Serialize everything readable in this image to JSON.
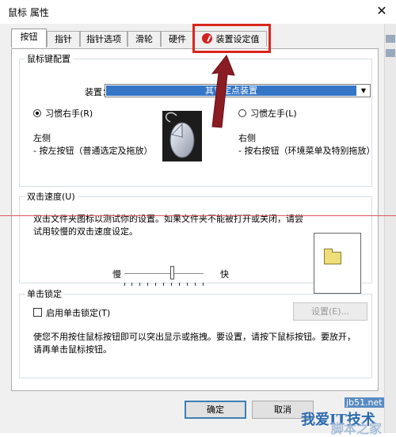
{
  "window": {
    "title": "鼠标 属性",
    "close_glyph": "✕"
  },
  "tabs": [
    {
      "label": "按钮",
      "active": true
    },
    {
      "label": "指针",
      "active": false
    },
    {
      "label": "指针选项",
      "active": false
    },
    {
      "label": "滑轮",
      "active": false
    },
    {
      "label": "硬件",
      "active": false
    },
    {
      "label": "装置设定值",
      "active": false,
      "icon": "synaptics-icon"
    }
  ],
  "button_config": {
    "legend": "鼠标键配置",
    "device_label": "装置：(V)",
    "device_value": "其它定点装置",
    "right_hand_label": "习惯右手(R)",
    "right_hand_checked": true,
    "left_hand_label": "习惯左手(L)",
    "left_hand_checked": false,
    "left_side_title": "左侧",
    "left_side_desc": "- 按左按钮（普通选定及拖放）",
    "right_side_title": "右侧",
    "right_side_desc": "- 按右按钮（环境菜单及特别拖放）"
  },
  "double_click": {
    "legend": "双击速度(U)",
    "description_line1": "双击文件夹图标以测试你的设置。如果文件夹不能被打开或关闭，请尝",
    "description_line2": "试用较慢的双击速度设定。",
    "slow_label": "慢",
    "fast_label": "快",
    "speed_fraction": 0.6
  },
  "click_lock": {
    "legend": "单击锁定",
    "checkbox_label": "启用单击锁定(T)",
    "checked": false,
    "settings_button": "设置(E)...",
    "description_line1": "使您不用按住鼠标按钮即可以突出显示或拖拽。要设置，请按下鼠标按钮。要放开，",
    "description_line2": "请再单击鼠标按钮。"
  },
  "footer": {
    "ok_label": "确定",
    "cancel_label": "取消"
  },
  "watermark": {
    "main": "我爱IT技术",
    "site": "jb51.net",
    "brand": "脚本之家"
  },
  "colors": {
    "highlight": "#d9261c",
    "selection": "#3476c6",
    "guide_line": "#e0545e"
  }
}
